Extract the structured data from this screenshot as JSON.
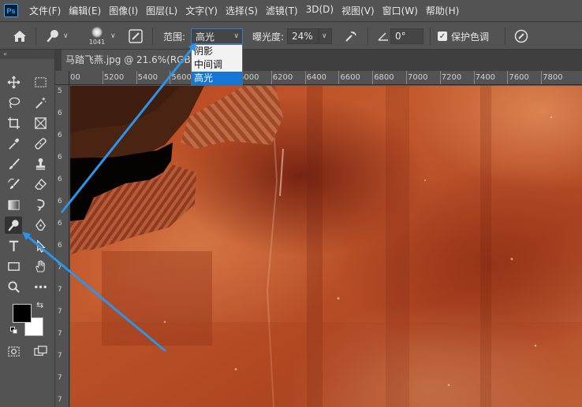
{
  "app": {
    "logo_text": "Ps"
  },
  "menu": [
    "文件(F)",
    "编辑(E)",
    "图像(I)",
    "图层(L)",
    "文字(Y)",
    "选择(S)",
    "滤镜(T)",
    "3D(D)",
    "视图(V)",
    "窗口(W)",
    "帮助(H)"
  ],
  "options": {
    "brush_size": "1041",
    "range_label": "范围:",
    "range_value": "高光",
    "range_options": [
      "阴影",
      "中间调",
      "高光"
    ],
    "exposure_label": "曝光度:",
    "exposure_value": "24%",
    "angle_value": "0°",
    "protect_tones_label": "保护色调",
    "protect_tones_checked": true
  },
  "document": {
    "tab_title": "马踏飞燕.jpg @ 21.6%(RGB/8#)"
  },
  "ruler": {
    "h_ticks": [
      "00",
      "5200",
      "5400",
      "5600",
      "5800",
      "6000",
      "6200",
      "6400",
      "6600",
      "6800",
      "7000",
      "7200",
      "7400",
      "7600",
      "7800"
    ],
    "v_ticks": [
      "5",
      "6",
      "6",
      "6",
      "6",
      "6",
      "6",
      "6",
      "7",
      "7",
      "7",
      "7",
      "7",
      "7",
      "7"
    ]
  },
  "colors": {
    "accent": "#1476d6",
    "arrow": "#2b95e9",
    "panel": "#535353"
  }
}
